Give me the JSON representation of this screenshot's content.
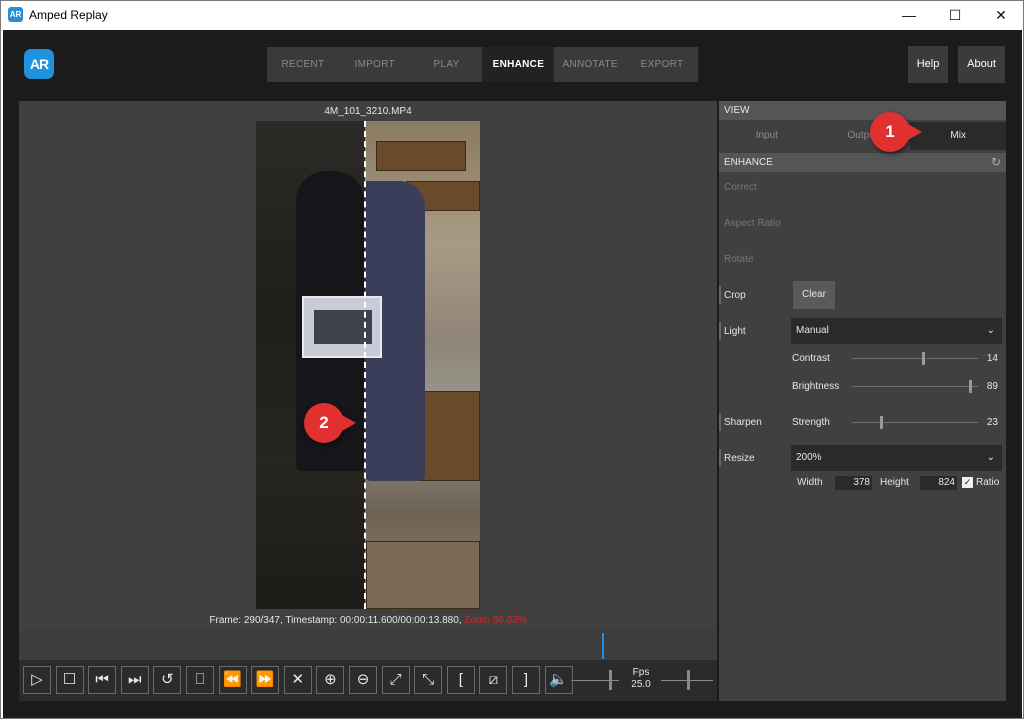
{
  "window": {
    "title": "Amped Replay",
    "minimize": "—",
    "maximize": "☐",
    "close": "✕"
  },
  "app": {
    "logo_text": "AR",
    "nav_tabs": [
      "RECENT",
      "IMPORT",
      "PLAY",
      "ENHANCE",
      "ANNOTATE",
      "EXPORT"
    ],
    "active_tab": "ENHANCE",
    "help_label": "Help",
    "about_label": "About"
  },
  "viewer": {
    "filename": "4M_101_3210.MP4",
    "frame_info": "Frame: 290/347, Timestamp: 00:00:11.600/00:00:13.880,",
    "zoom_info": "Zoom 96.03%",
    "fps_label": "Fps",
    "fps_value": "25.0",
    "timeline_position": 0.835,
    "controls": [
      {
        "name": "play-icon",
        "glyph": "▷"
      },
      {
        "name": "stop-icon",
        "glyph": "☐"
      },
      {
        "name": "step-back-icon",
        "glyph": "⏮"
      },
      {
        "name": "step-forward-icon",
        "glyph": "⏭"
      },
      {
        "name": "loop-icon",
        "glyph": "↺"
      },
      {
        "name": "bookmark-icon",
        "glyph": "⎕"
      },
      {
        "name": "rewind-icon",
        "glyph": "⏪"
      },
      {
        "name": "fast-forward-icon",
        "glyph": "⏩"
      },
      {
        "name": "close-icon",
        "glyph": "✕"
      },
      {
        "name": "zoom-in-icon",
        "glyph": "⊕"
      },
      {
        "name": "zoom-out-icon",
        "glyph": "⊖"
      },
      {
        "name": "expand-icon",
        "glyph": "⤢"
      },
      {
        "name": "shrink-icon",
        "glyph": "⤡"
      },
      {
        "name": "mark-in-icon",
        "glyph": "["
      },
      {
        "name": "clear-marks-icon",
        "glyph": "⧄"
      },
      {
        "name": "mark-out-icon",
        "glyph": "]"
      },
      {
        "name": "volume-icon",
        "glyph": "🔈"
      }
    ]
  },
  "panel": {
    "view_header": "VIEW",
    "view_tabs": [
      "Input",
      "Output",
      "Mix"
    ],
    "active_view": "Mix",
    "enhance_header": "ENHANCE",
    "reset_glyph": "↻",
    "correct_label": "Correct",
    "aspect_ratio_label": "Aspect Ratio",
    "rotate_label": "Rotate",
    "crop_label": "Crop",
    "clear_label": "Clear",
    "light_label": "Light",
    "light_mode": "Manual",
    "contrast_label": "Contrast",
    "contrast_value": "14",
    "contrast_level": 0.56,
    "brightness_label": "Brightness",
    "brightness_value": "89",
    "brightness_level": 0.94,
    "sharpen_label": "Sharpen",
    "strength_label": "Strength",
    "strength_value": "23",
    "strength_level": 0.23,
    "resize_label": "Resize",
    "resize_value": "200%",
    "width_label": "Width",
    "width_value": "378",
    "height_label": "Height",
    "height_value": "824",
    "ratio_label": "Ratio",
    "chevron": "⌄"
  },
  "callouts": {
    "one": "1",
    "two": "2"
  },
  "colors": {
    "accent": "#1e90e8",
    "callout": "#e03030",
    "zoom_text": "#e02020"
  }
}
